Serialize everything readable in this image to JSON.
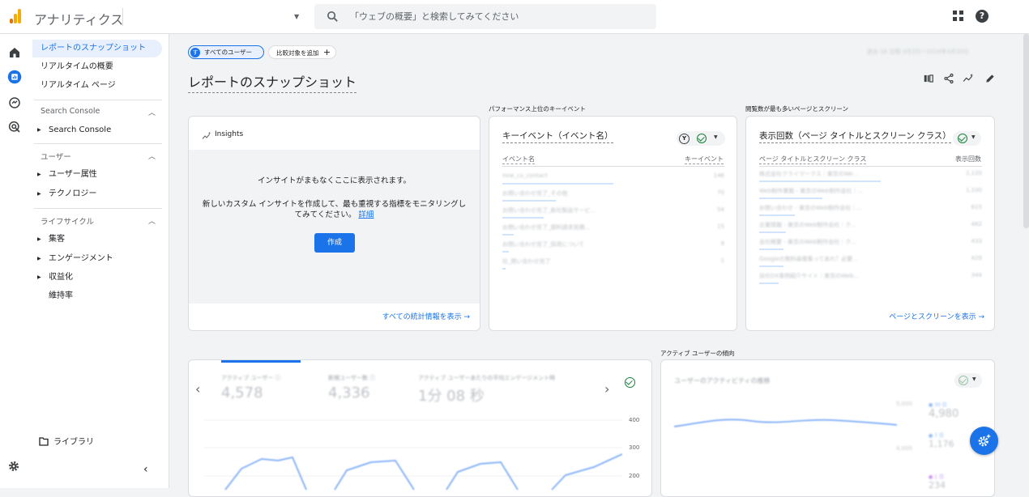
{
  "topbar": {
    "app_title": "アナリティクス",
    "search_placeholder": "「ウェブの概要」と検索してみてください",
    "help_glyph": "?"
  },
  "sidebar": {
    "items": [
      {
        "label": "レポートのスナップショット",
        "active": true
      },
      {
        "label": "リアルタイムの概要"
      },
      {
        "label": "リアルタイム ページ"
      }
    ],
    "section_search_console": "Search Console",
    "search_console_item": "Search Console",
    "section_user": "ユーザー",
    "user_items": [
      "ユーザー属性",
      "テクノロジー"
    ],
    "section_lifecycle": "ライフサイクル",
    "lifecycle_items": [
      "集客",
      "エンゲージメント",
      "収益化",
      "維持率"
    ],
    "library": "ライブラリ"
  },
  "filters": {
    "all_users_chip": "すべてのユーザー",
    "all_users_avatar": "す",
    "compare_chip": "比較対象を追加",
    "date_range": "過去 28 日間 3月3日～2024年3月30日"
  },
  "page_title": "レポートのスナップショット",
  "groups": {
    "top_events": "パフォーマンス上位のキーイベント",
    "top_pages": "閲覧数が最も多いページとスクリーン",
    "active_trend": "アクティブ ユーザーの傾向"
  },
  "insights": {
    "title": "Insights",
    "line1": "インサイトがまもなくここに表示されます。",
    "line2": "新しいカスタム インサイトを作成して、最も重視する指標をモニタリングしてみてください。",
    "detail_link": "詳細",
    "create_button": "作成",
    "see_all": "すべての統計情報を表示 →"
  },
  "events_card": {
    "title": "キーイベント（イベント名）",
    "col_name": "イベント名",
    "col_value": "キーイベント",
    "rows": [
      {
        "name": "new_cv_contact",
        "value": "146",
        "share": 1.0
      },
      {
        "name": "お問い合わせ完了_その他",
        "value": "70",
        "share": 0.48
      },
      {
        "name": "お問い合わせ完了_新社製品サービ...",
        "value": "54",
        "share": 0.37
      },
      {
        "name": "お問い合わせ完了_資料請求見積...",
        "value": "15",
        "share": 0.1
      },
      {
        "name": "お問い合わせ完了_採用について",
        "value": "9",
        "share": 0.06
      },
      {
        "name": "社_問い合わせ完了",
        "value": "1",
        "share": 0.01
      }
    ]
  },
  "pages_card": {
    "title": "表示回数（ページ タイトルとスクリーン クラス）",
    "col_name": "ページ タイトルとスクリーン クラス",
    "col_value": "表示回数",
    "rows": [
      {
        "name": "株式会社クライマークス｜東京のWe...",
        "value": "2,120",
        "share": 1.0
      },
      {
        "name": "Web制作業務 - 東京のWeb制作会社｜...",
        "value": "1,100",
        "share": 0.52
      },
      {
        "name": "お問い合わせ - 東京のWeb制作会社｜...",
        "value": "615",
        "share": 0.29
      },
      {
        "name": "企業情報 - 東京のWeb制作会社｜ク...",
        "value": "462",
        "share": 0.22
      },
      {
        "name": "会社概要 - 東京のWeb制作会社｜ク...",
        "value": "433",
        "share": 0.2
      },
      {
        "name": "Googleの無料画像集ってあれ？必要...",
        "value": "429",
        "share": 0.2
      },
      {
        "name": "自社DX事例紹介サイト｜東京のWeb...",
        "value": "344",
        "share": 0.16
      }
    ],
    "see_link": "ページとスクリーンを表示 →"
  },
  "overview_card": {
    "kpis": [
      {
        "label": "アクティブ ユーザー ⓘ",
        "value": "4,578"
      },
      {
        "label": "新規ユーザー数 ⓘ",
        "value": "4,336"
      },
      {
        "label": "アクティブ ユーザーあたりの平均エンゲージメント時",
        "value": "1分 08 秒"
      }
    ],
    "y_ticks": [
      "400",
      "300",
      "200"
    ],
    "nav_prev": "‹",
    "nav_next": "›"
  },
  "trend_card": {
    "title": "ユーザーのアクティビティの推移",
    "legend": [
      {
        "label": "● 30 日",
        "value": "4,980"
      },
      {
        "label": "● 7 日",
        "value": "1,176"
      },
      {
        "label": "● 1 日",
        "value": "234"
      }
    ],
    "y_ticks": [
      "5,000",
      "4,000"
    ]
  },
  "colors": {
    "accent": "#1a73e8",
    "success": "#188038",
    "logo_orange": "#f9ab00",
    "logo_dark": "#e37400"
  }
}
